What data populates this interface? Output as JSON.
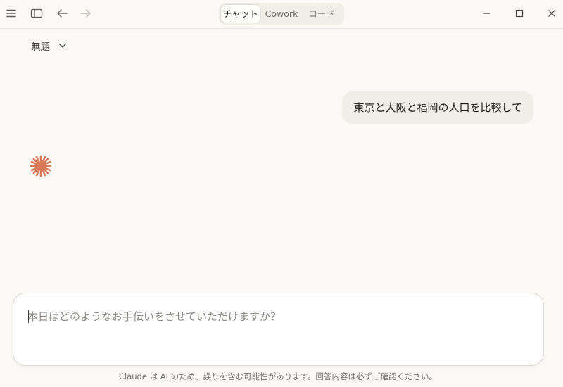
{
  "window": {
    "icons": {
      "menu": "hamburger-menu-icon",
      "sidebar": "sidebar-toggle-icon",
      "back": "arrow-left-icon",
      "forward": "arrow-right-icon",
      "minimize": "minimize-icon",
      "maximize": "maximize-icon",
      "close": "close-icon"
    }
  },
  "tabs": [
    {
      "label": "チャット",
      "active": true
    },
    {
      "label": "Cowork",
      "active": false
    },
    {
      "label": "コード",
      "active": false
    }
  ],
  "conversation": {
    "title": "無題",
    "title_icon": "chevron-down-icon"
  },
  "messages": [
    {
      "role": "user",
      "text": "東京と大阪と福岡の人口を比較して"
    }
  ],
  "assistant": {
    "icon": "claude-spark-icon",
    "accent_color": "#d97757"
  },
  "composer": {
    "placeholder": "本日はどのようなお手伝いをさせていただけますか？",
    "value": ""
  },
  "footer": {
    "disclaimer": "Claude は AI のため、誤りを含む可能性があります。回答内容は必ずご確認ください。"
  }
}
